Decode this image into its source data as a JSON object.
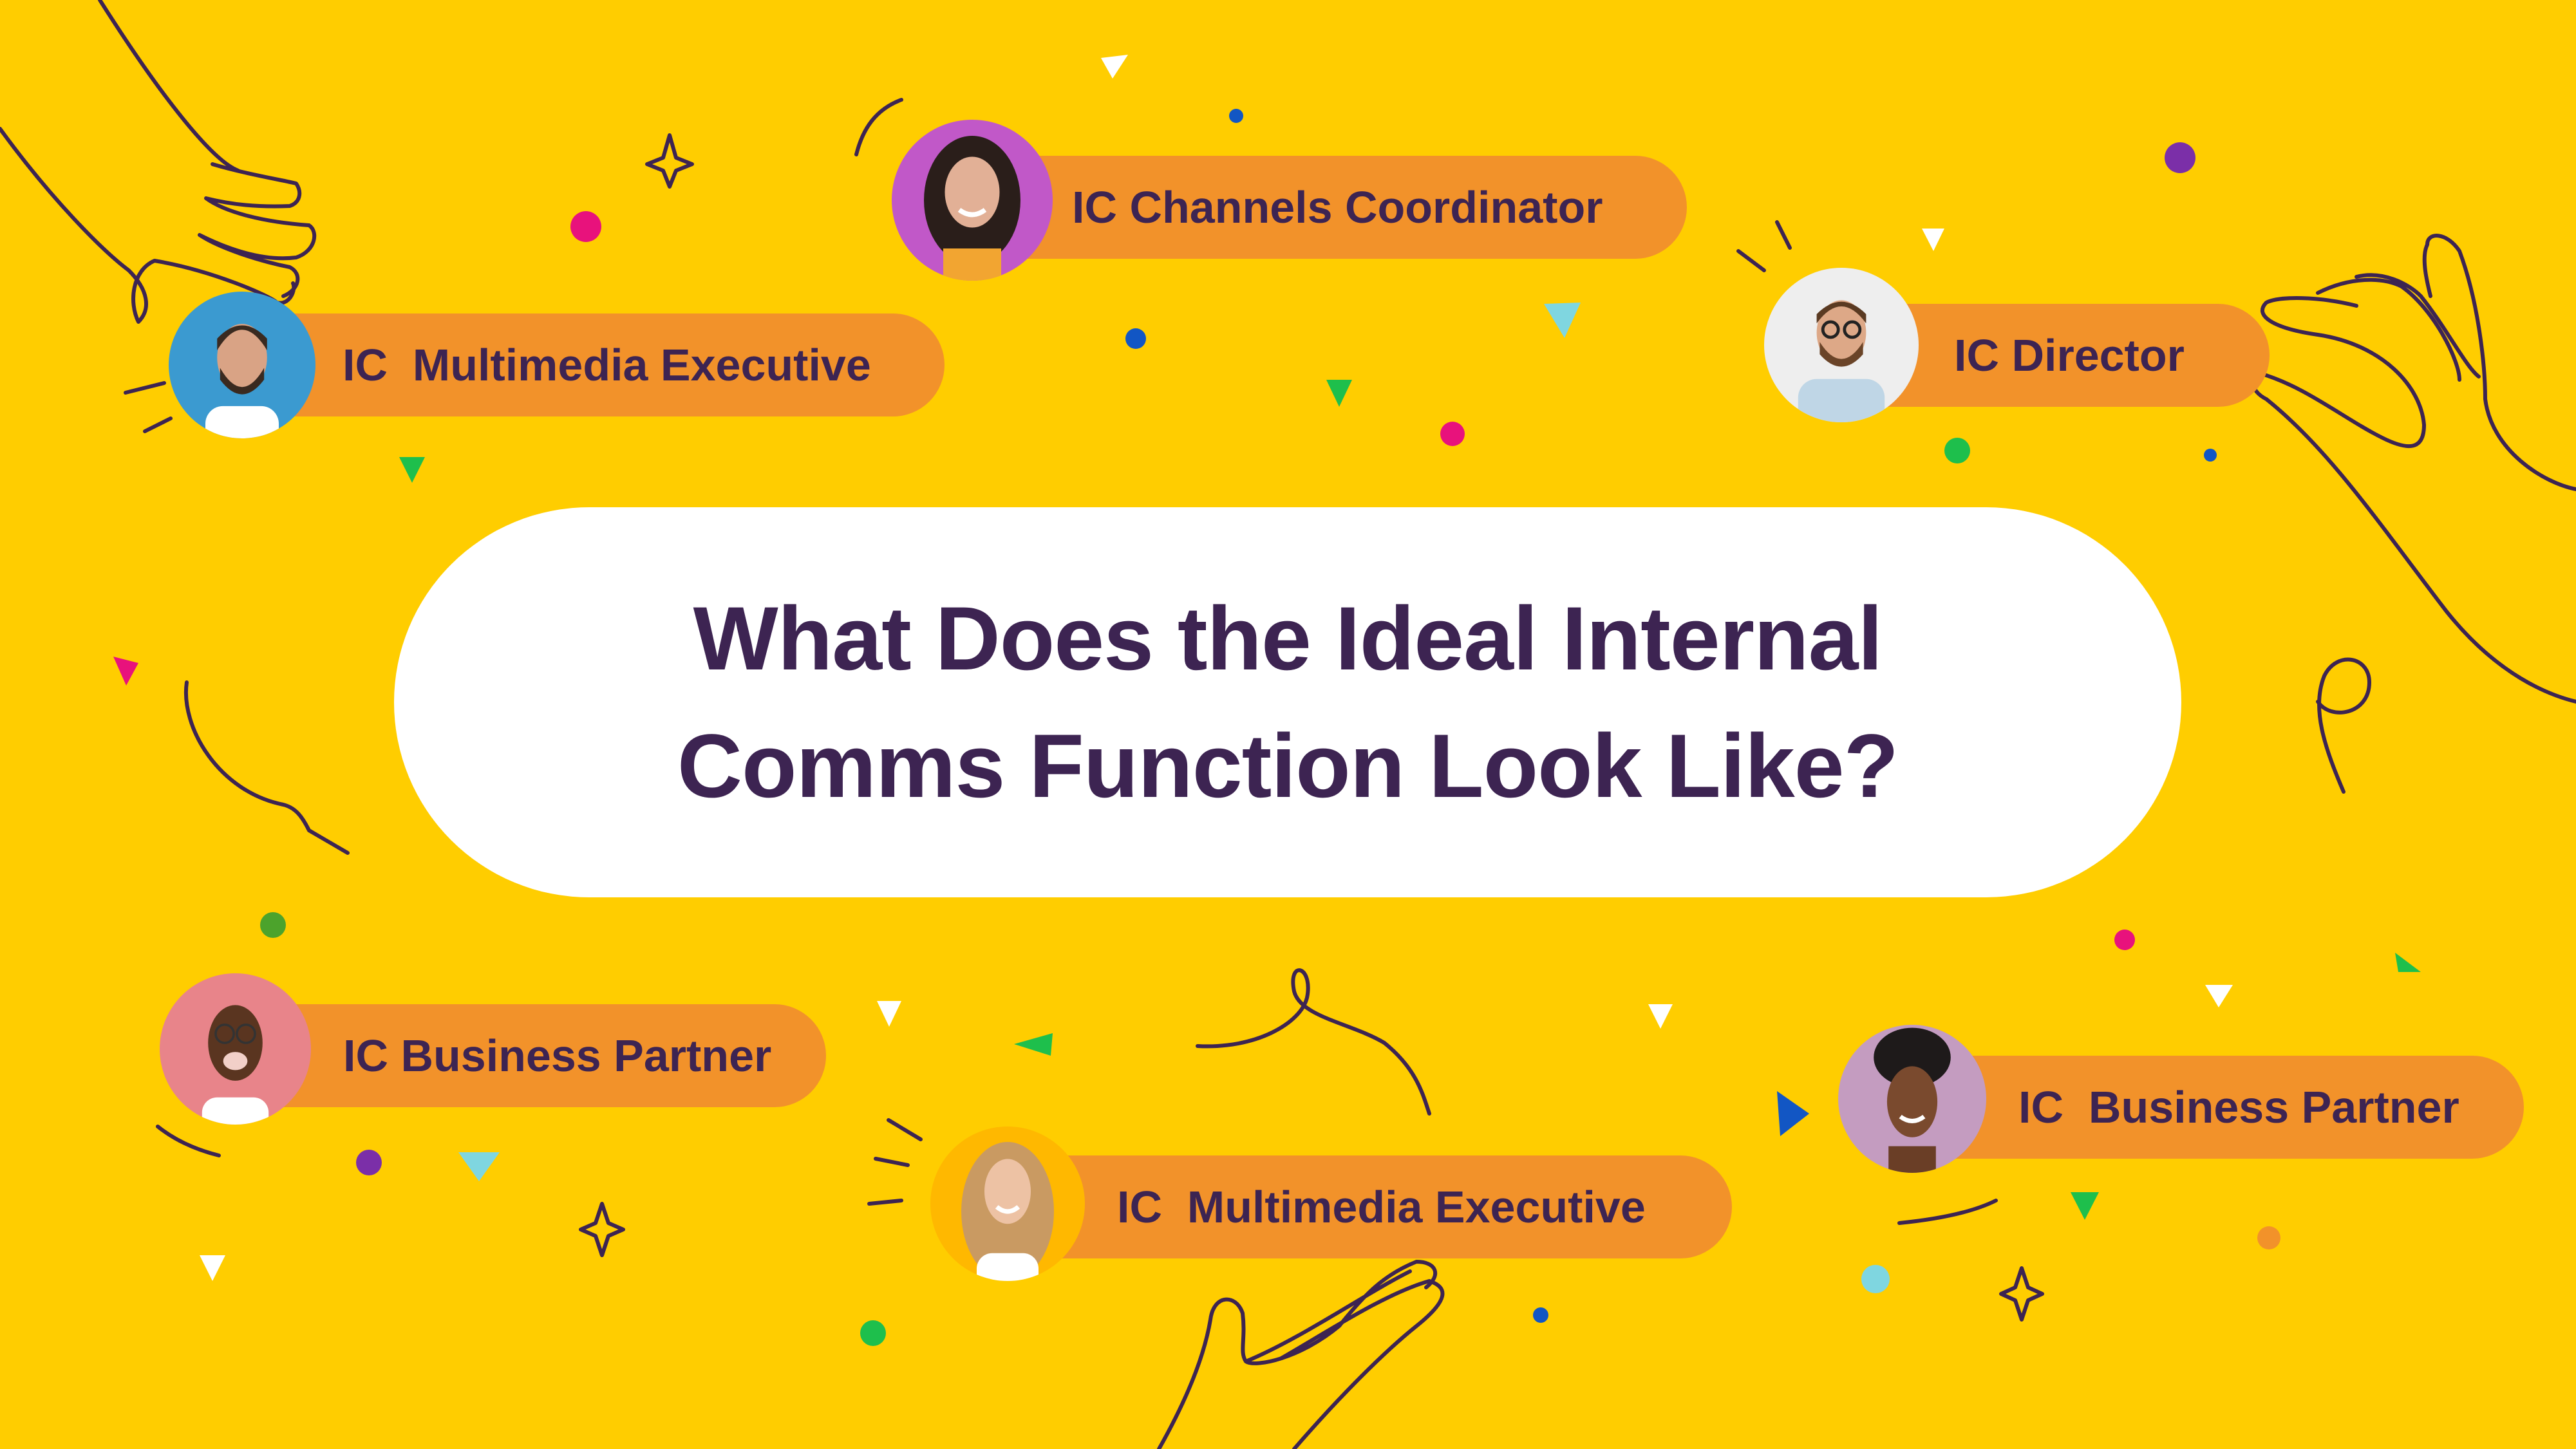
{
  "headline": {
    "line1": "What Does the Ideal Internal",
    "line2": "Comms Function Look Like?"
  },
  "roles": [
    {
      "label": "IC Channels Coordinator",
      "avatar_bg": "#C158C8",
      "person": "woman-dark-hair"
    },
    {
      "label": "IC  Multimedia Executive",
      "avatar_bg": "#3B9AD0",
      "person": "man-beard"
    },
    {
      "label": "IC Director",
      "avatar_bg": "#EEEEEE",
      "person": "man-glasses-beard"
    },
    {
      "label": "IC Business Partner",
      "avatar_bg": "#E8848A",
      "person": "man-glasses-smiling"
    },
    {
      "label": "IC  Multimedia Executive",
      "avatar_bg": "#FFB800",
      "person": "woman-blonde"
    },
    {
      "label": "IC  Business Partner",
      "avatar_bg": "#C49CC0",
      "person": "woman-curly-hair"
    }
  ],
  "colors": {
    "background": "#FFCD00",
    "pill": "#F2922A",
    "text": "#3D2452",
    "line_art": "#3D2452"
  }
}
